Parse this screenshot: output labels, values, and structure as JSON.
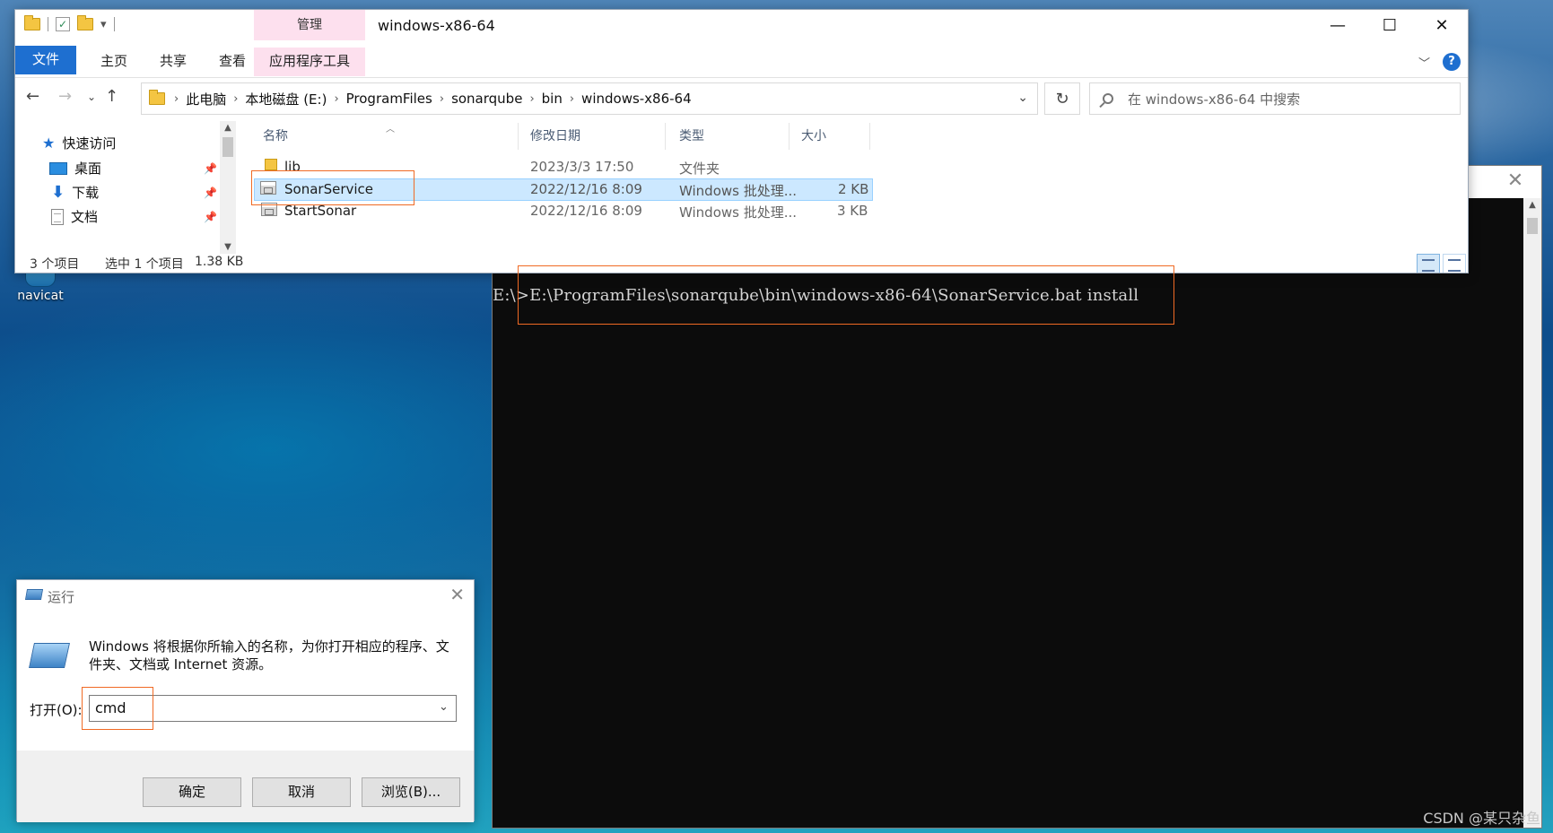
{
  "desktop": {
    "icons": [
      {
        "label": "navicat"
      }
    ],
    "watermark": "CSDN @某只杂鱼"
  },
  "explorer": {
    "window_title": "windows-x86-64",
    "context_tab_header": "管理",
    "ribbon_tabs": [
      "文件",
      "主页",
      "共享",
      "查看",
      "应用程序工具"
    ],
    "breadcrumb": [
      "此电脑",
      "本地磁盘 (E:)",
      "ProgramFiles",
      "sonarqube",
      "bin",
      "windows-x86-64"
    ],
    "search_placeholder": "在 windows-x86-64 中搜索",
    "nav_items": [
      {
        "label": "快速访问",
        "icon": "star-icon"
      },
      {
        "label": "桌面",
        "icon": "desktop-icon"
      },
      {
        "label": "下载",
        "icon": "download-icon"
      },
      {
        "label": "文档",
        "icon": "document-icon"
      }
    ],
    "columns": [
      "名称",
      "修改日期",
      "类型",
      "大小"
    ],
    "files": [
      {
        "name": "lib",
        "modified": "2023/3/3 17:50",
        "type": "文件夹",
        "size": "",
        "icon": "folder-icon",
        "selected": false
      },
      {
        "name": "SonarService",
        "modified": "2022/12/16 8:09",
        "type": "Windows 批处理...",
        "size": "2 KB",
        "icon": "batch-file-icon",
        "selected": true
      },
      {
        "name": "StartSonar",
        "modified": "2022/12/16 8:09",
        "type": "Windows 批处理...",
        "size": "3 KB",
        "icon": "batch-file-icon",
        "selected": false
      }
    ],
    "status": {
      "item_count": "3 个项目",
      "selection": "选中 1 个项目",
      "size": "1.38 KB"
    }
  },
  "cmd": {
    "command_line": "E:\\>E:\\ProgramFiles\\sonarqube\\bin\\windows-x86-64\\SonarService.bat install"
  },
  "run_dialog": {
    "title": "运行",
    "description": "Windows 将根据你所输入的名称，为你打开相应的程序、文件夹、文档或 Internet 资源。",
    "open_label": "打开(O):",
    "open_value": "cmd",
    "buttons": {
      "ok": "确定",
      "cancel": "取消",
      "browse": "浏览(B)..."
    }
  },
  "colors": {
    "highlight": "#f06a24",
    "ribbon_file_tab": "#1e6fd0",
    "context_tab": "#fde0ee",
    "selection": "#cce8ff"
  }
}
